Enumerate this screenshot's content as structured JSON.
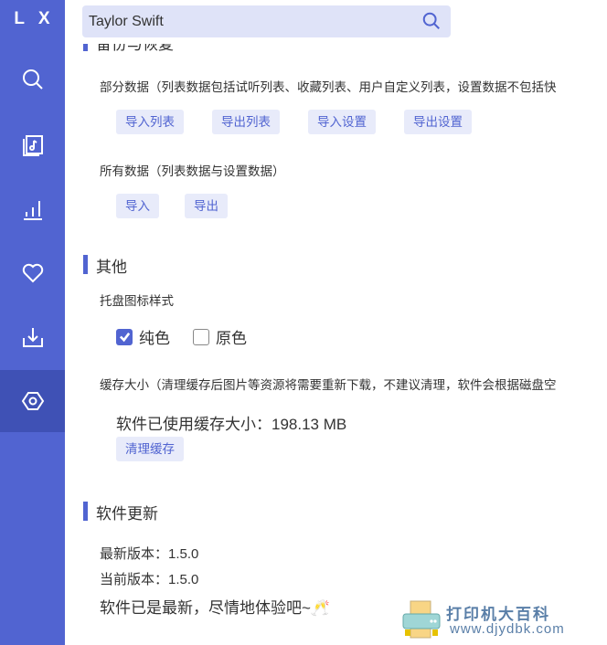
{
  "app": {
    "logo": "L X"
  },
  "sidebar": {
    "items": [
      {
        "name": "search",
        "icon": "search-icon"
      },
      {
        "name": "song-list",
        "icon": "music-list-icon"
      },
      {
        "name": "leaderboard",
        "icon": "bar-chart-icon"
      },
      {
        "name": "my-list",
        "icon": "heart-icon"
      },
      {
        "name": "download",
        "icon": "download-icon"
      },
      {
        "name": "settings",
        "icon": "settings-hex-icon",
        "active": true
      }
    ]
  },
  "search": {
    "value": "Taylor Swift",
    "placeholder": ""
  },
  "backup": {
    "title": "备份与恢复",
    "partial_label": "部分数据（列表数据包括试听列表、收藏列表、用户自定义列表，设置数据不包括快",
    "partial_buttons": [
      "导入列表",
      "导出列表",
      "导入设置",
      "导出设置"
    ],
    "all_label": "所有数据（列表数据与设置数据）",
    "all_buttons": [
      "导入",
      "导出"
    ]
  },
  "other": {
    "title": "其他",
    "tray_label": "托盘图标样式",
    "tray_options": [
      {
        "label": "纯色",
        "checked": true
      },
      {
        "label": "原色",
        "checked": false
      }
    ],
    "cache_label": "缓存大小（清理缓存后图片等资源将需要重新下载，不建议清理，软件会根据磁盘空",
    "cache_used": "软件已使用缓存大小：198.13 MB",
    "clear_cache_button": "清理缓存"
  },
  "update": {
    "title": "软件更新",
    "latest_version": "最新版本：1.5.0",
    "current_version": "当前版本：1.5.0",
    "status": "软件已是最新，尽情地体验吧~🥂"
  },
  "watermark": {
    "line1": "打印机大百科",
    "line2": "www.djydbk.com"
  },
  "colors": {
    "accent": "#5164d1",
    "active_nav": "#3f51b5",
    "button_bg": "#e8ebfa",
    "search_bg": "#dfe3f8"
  }
}
